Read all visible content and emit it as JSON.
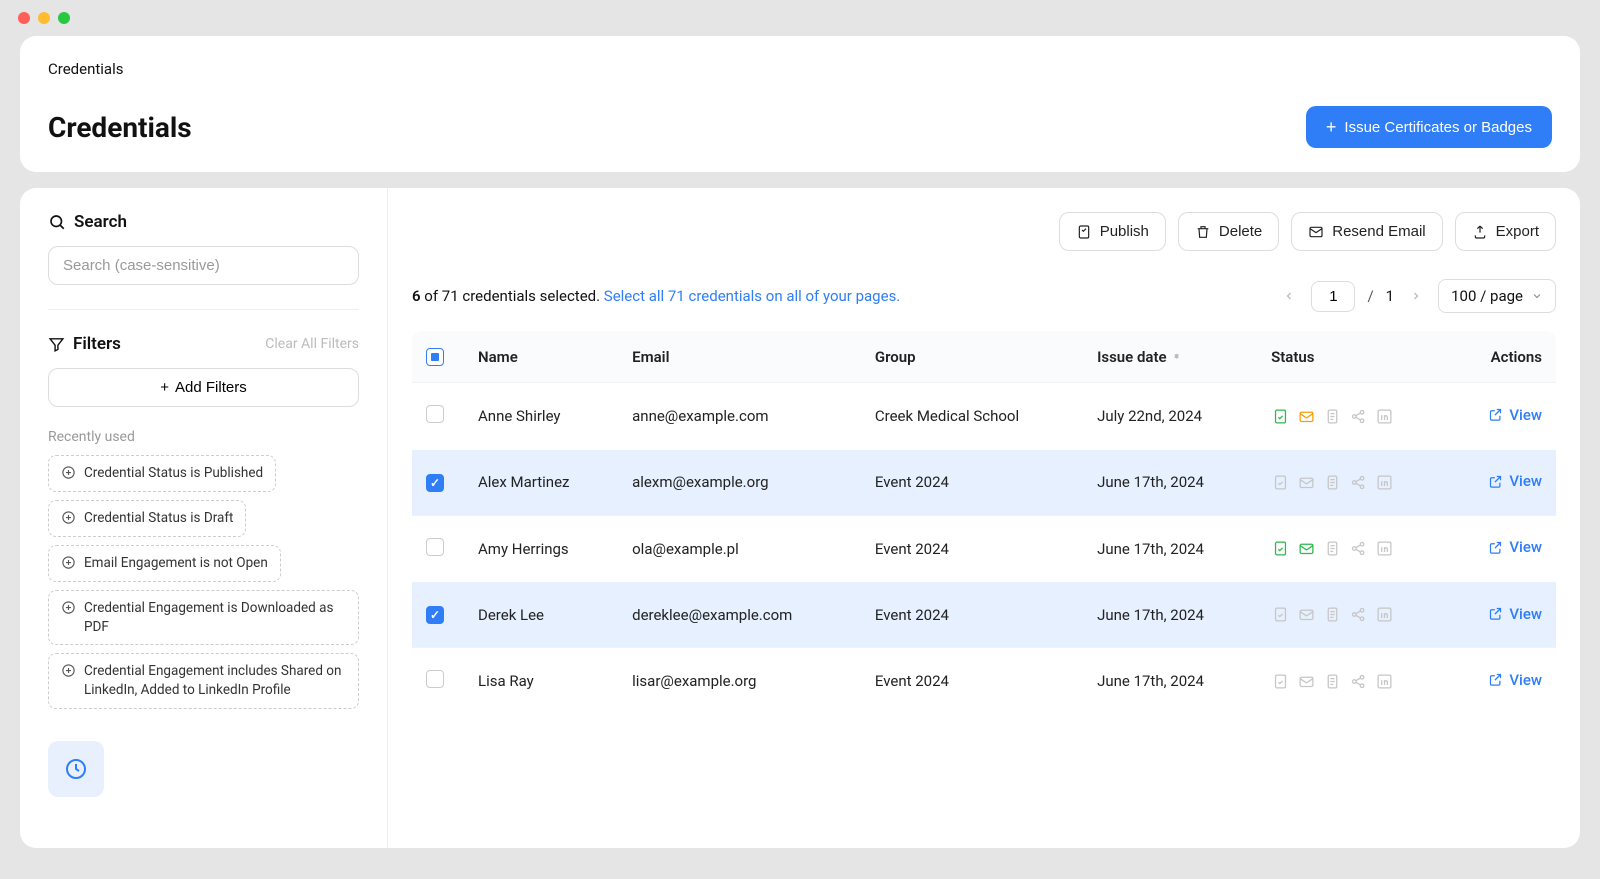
{
  "breadcrumb": "Credentials",
  "header": {
    "title": "Credentials",
    "primary_button": "Issue Certificates or Badges"
  },
  "sidebar": {
    "search_title": "Search",
    "search_placeholder": "Search (case-sensitive)",
    "filters_title": "Filters",
    "clear_filters": "Clear All Filters",
    "add_filters": "Add Filters",
    "recently_used": "Recently used",
    "chips": [
      "Credential Status is Published",
      "Credential Status is Draft",
      "Email Engagement is not Open",
      "Credential Engagement is Downloaded as PDF",
      "Credential Engagement includes Shared on LinkedIn, Added to LinkedIn Profile"
    ]
  },
  "toolbar": {
    "publish": "Publish",
    "delete": "Delete",
    "resend": "Resend Email",
    "export": "Export"
  },
  "selection": {
    "selected_count": "6",
    "of_text": " of 71 credentials selected. ",
    "select_all": "Select all 71 credentials on all of your pages."
  },
  "pagination": {
    "current": "1",
    "total": "1",
    "page_size": "100 / page"
  },
  "table": {
    "columns": {
      "name": "Name",
      "email": "Email",
      "group": "Group",
      "issue_date": "Issue date",
      "status": "Status",
      "actions": "Actions"
    },
    "view": "View",
    "rows": [
      {
        "selected": false,
        "name": "Anne Shirley",
        "email": "anne@example.com",
        "group": "Creek Medical School",
        "issue_date": "July 22nd, 2024",
        "icons": [
          "doc-green",
          "mail-orange",
          "page-gray",
          "share-gray",
          "linkedin-gray"
        ]
      },
      {
        "selected": true,
        "name": "Alex Martinez",
        "email": "alexm@example.org",
        "group": "Event 2024",
        "issue_date": "June 17th, 2024",
        "icons": [
          "doc-gray",
          "mail-gray",
          "page-gray",
          "share-gray",
          "linkedin-gray"
        ]
      },
      {
        "selected": false,
        "name": "Amy Herrings",
        "email": "ola@example.pl",
        "group": "Event 2024",
        "issue_date": "June 17th, 2024",
        "icons": [
          "doc-green",
          "mail-green",
          "page-gray",
          "share-gray",
          "linkedin-gray"
        ]
      },
      {
        "selected": true,
        "name": "Derek Lee",
        "email": "dereklee@example.com",
        "group": "Event 2024",
        "issue_date": "June 17th, 2024",
        "icons": [
          "doc-gray",
          "mail-gray",
          "page-gray",
          "share-gray",
          "linkedin-gray"
        ]
      },
      {
        "selected": false,
        "name": "Lisa Ray",
        "email": "lisar@example.org",
        "group": "Event 2024",
        "issue_date": "June 17th, 2024",
        "icons": [
          "doc-gray",
          "mail-gray",
          "page-gray",
          "share-gray",
          "linkedin-gray"
        ]
      }
    ]
  },
  "colors": {
    "primary": "#2f7ef7",
    "green": "#2db84c",
    "orange": "#f59e0b",
    "gray": "#c6c6c6"
  }
}
